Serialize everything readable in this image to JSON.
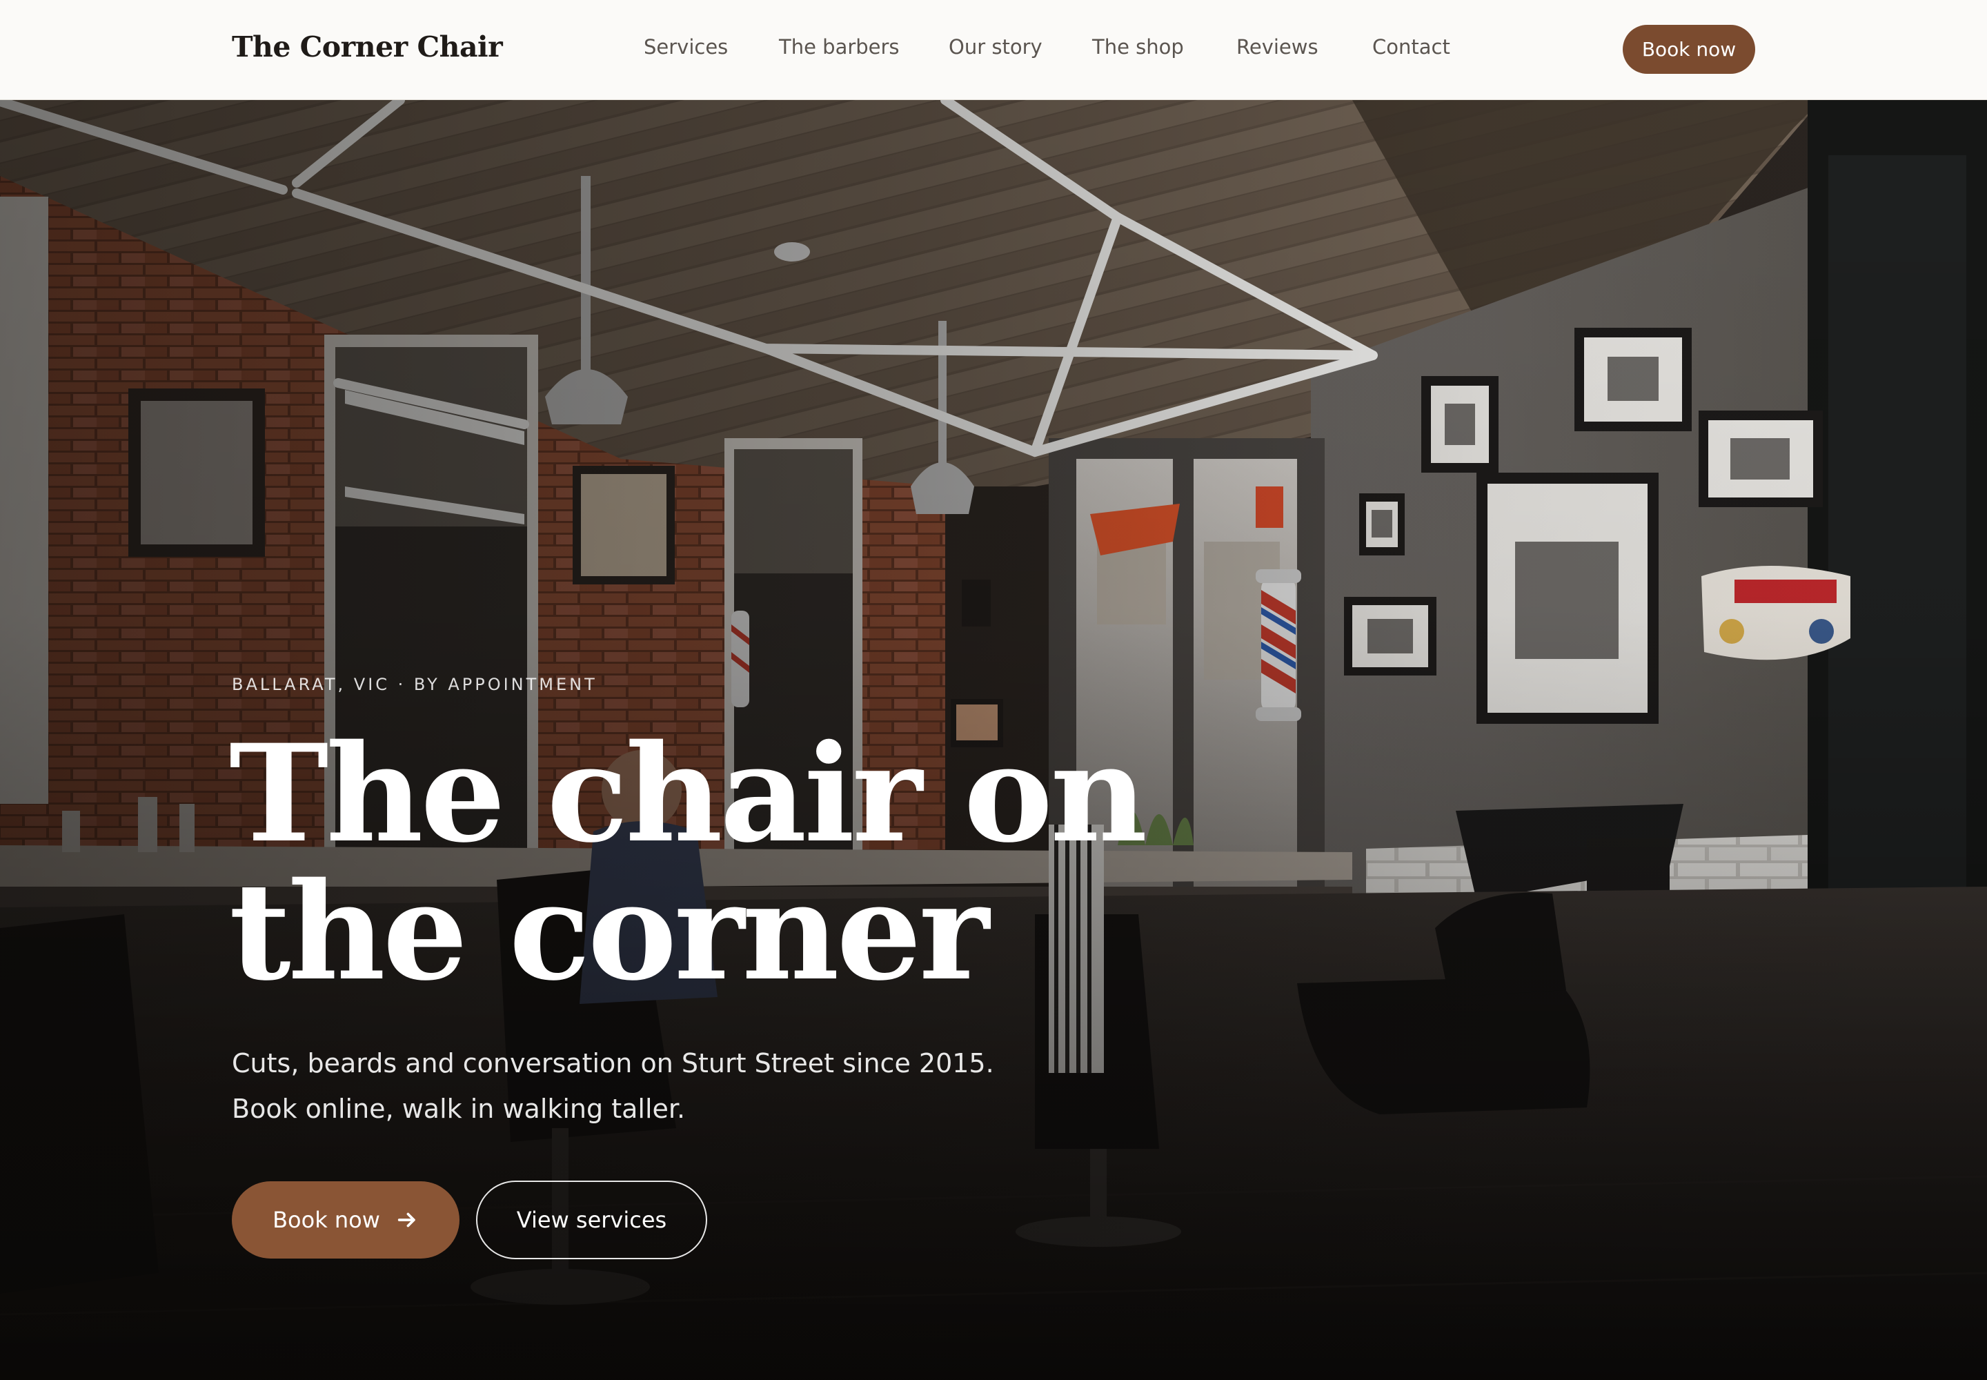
{
  "header": {
    "logo": "The Corner Chair",
    "nav": [
      "Services",
      "The barbers",
      "Our story",
      "The shop",
      "Reviews",
      "Contact"
    ],
    "cta_label": "Book now"
  },
  "hero": {
    "eyebrow": "BALLARAT, VIC · BY APPOINTMENT",
    "headline_line1": "The chair on",
    "headline_line2": "the corner",
    "subcopy_line1": "Cuts, beards and conversation on Sturt Street since 2015.",
    "subcopy_line2": "Book online, walk in walking taller.",
    "primary_button": "Book now",
    "primary_button_icon": "arrow-right-icon",
    "secondary_button": "View services"
  },
  "colors": {
    "brand_brown": "#7b4b2f",
    "header_bg": "#fbfaf8",
    "nav_text": "#5b5550"
  }
}
